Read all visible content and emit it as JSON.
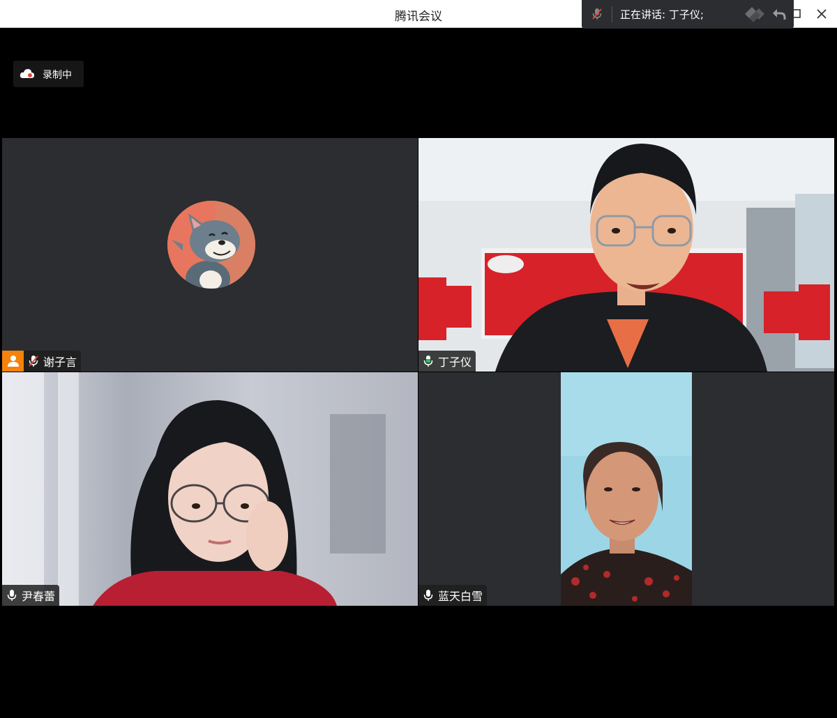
{
  "window": {
    "title": "腾讯会议"
  },
  "speaking_bar": {
    "text": "正在讲话: 丁子仪;",
    "mic_icon": "mic-muted-icon",
    "logo_icon": "tencent-meeting-logo-icon",
    "undo_icon": "undo-icon"
  },
  "recording": {
    "label": "录制中",
    "icon": "cloud-icon"
  },
  "participants": [
    {
      "name": "谢子言",
      "mic": "muted",
      "host": true,
      "video": "avatar"
    },
    {
      "name": "丁子仪",
      "mic": "active",
      "host": false,
      "video": "camera"
    },
    {
      "name": "尹春蕾",
      "mic": "on",
      "host": false,
      "video": "camera"
    },
    {
      "name": "蓝天白雪",
      "mic": "on",
      "host": false,
      "video": "camera"
    }
  ],
  "colors": {
    "active_speaker_border": "#22c55e",
    "host_badge": "#f5820b",
    "muted_mic": "#e2463b",
    "active_mic": "#22c55e"
  }
}
